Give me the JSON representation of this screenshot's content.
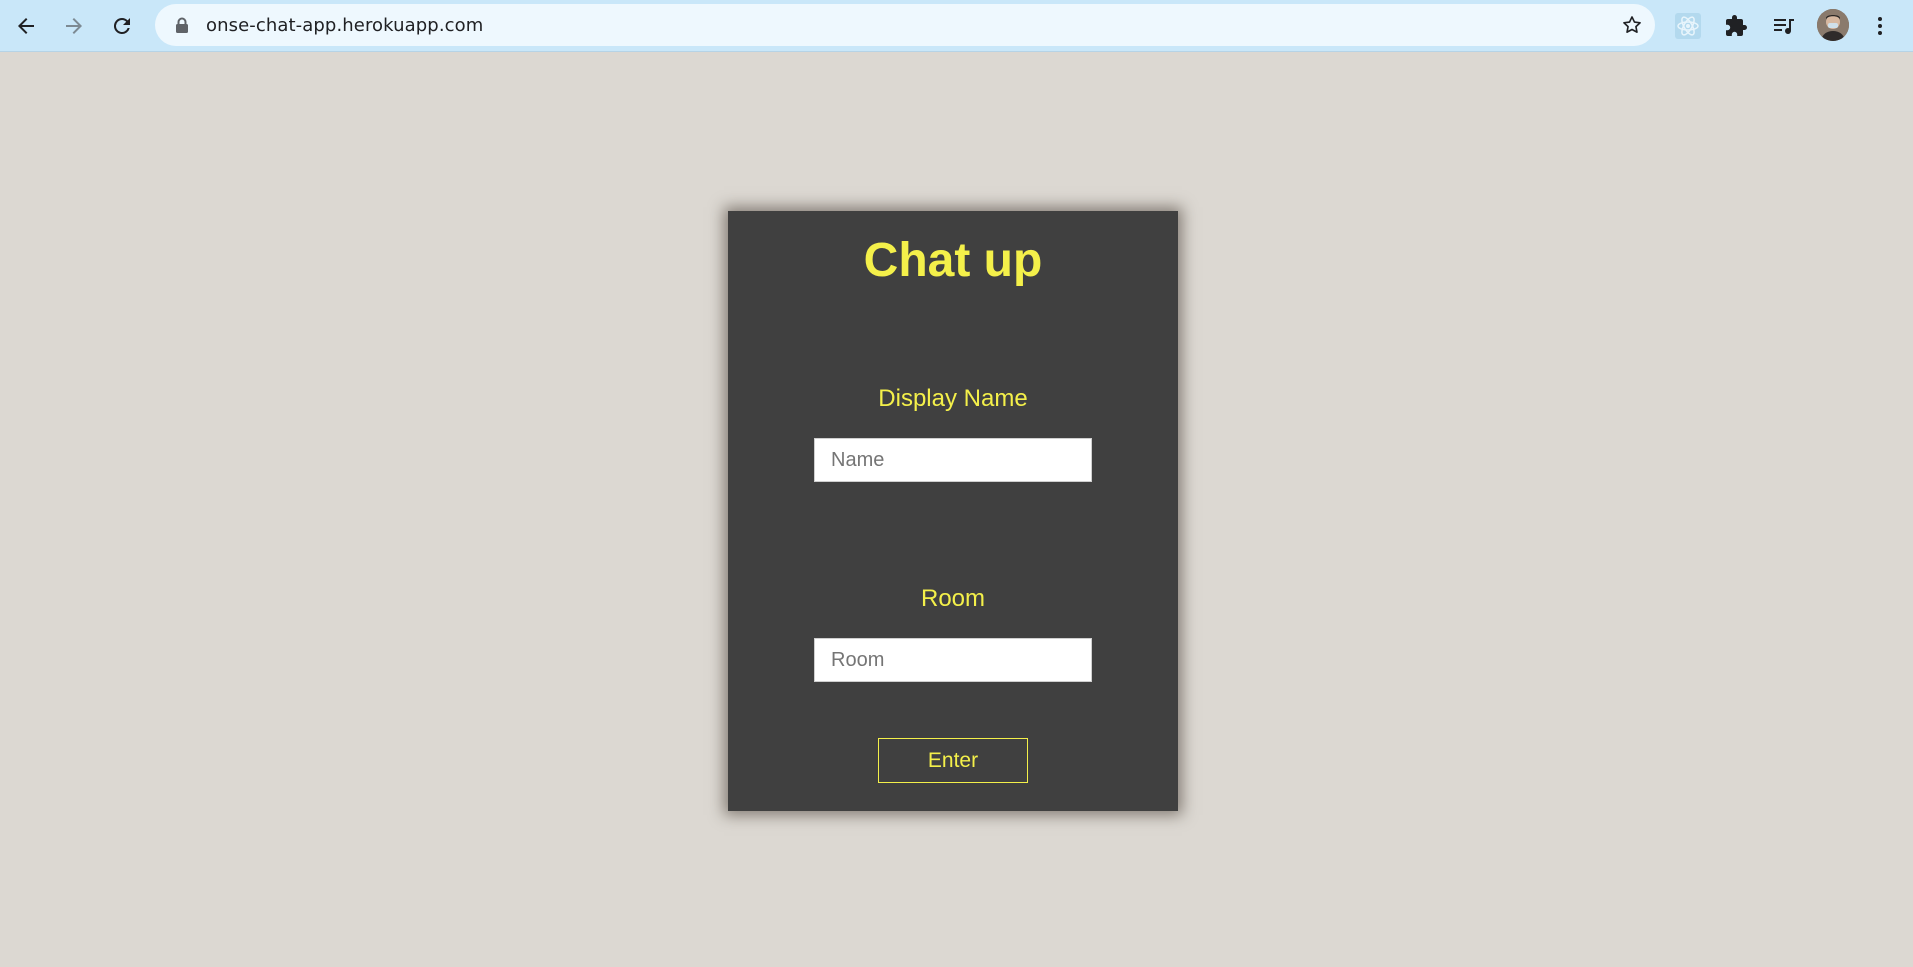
{
  "browser": {
    "url": "onse-chat-app.herokuapp.com",
    "icons": [
      "back-icon",
      "forward-icon",
      "reload-icon",
      "lock-icon",
      "bookmark-star-icon",
      "react-devtools-icon",
      "extensions-icon",
      "media-control-icon",
      "profile-avatar",
      "more-menu-icon"
    ]
  },
  "app": {
    "title": "Chat up",
    "display_name_label": "Display Name",
    "name_placeholder": "Name",
    "name_value": "",
    "room_label": "Room",
    "room_placeholder": "Room",
    "room_value": "",
    "enter_label": "Enter"
  },
  "colors": {
    "page_background": "#dcd8d2",
    "card_background": "#404040",
    "accent_yellow": "#f4f04a",
    "browser_bar": "#c9e7f9"
  }
}
